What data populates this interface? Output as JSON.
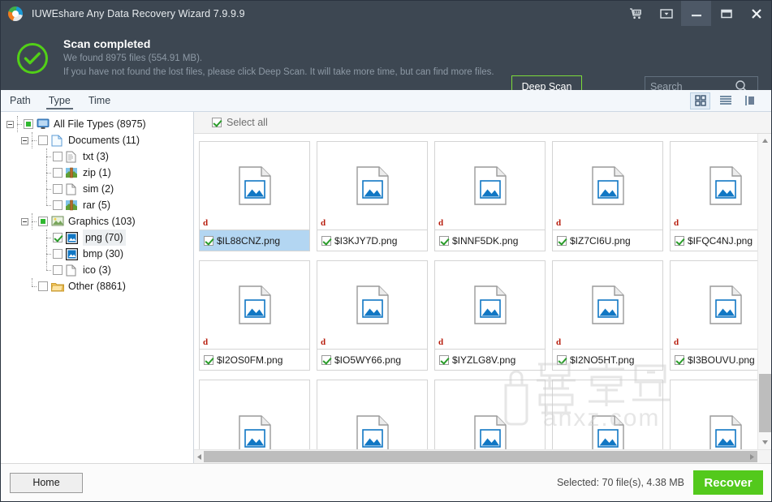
{
  "window": {
    "title": "IUWEshare Any Data Recovery Wizard 7.9.9.9",
    "logo_icon": "app-logo-icon",
    "buttons": [
      {
        "name": "cart-icon",
        "label": ""
      },
      {
        "name": "menu-dropdown-icon",
        "label": ""
      },
      {
        "name": "minimize-icon",
        "label": ""
      },
      {
        "name": "maximize-icon",
        "label": ""
      },
      {
        "name": "close-icon",
        "label": ""
      }
    ]
  },
  "scan": {
    "status_icon": "check-circle-icon",
    "title": "Scan completed",
    "line1": "We found 8975 files (554.91 MB).",
    "line2": "If you have not found the lost files, please click Deep Scan. It will take more time, but can find more files.",
    "deep_scan_label": "Deep Scan",
    "accent_green": "#7ddb3a"
  },
  "search": {
    "placeholder": "Search",
    "value": "",
    "icon": "search-icon"
  },
  "toolbar": {
    "tabs": [
      {
        "label": "Path",
        "active": false
      },
      {
        "label": "Type",
        "active": true
      },
      {
        "label": "Time",
        "active": false
      }
    ],
    "views": [
      {
        "name": "grid-view-icon",
        "active": true
      },
      {
        "name": "list-view-icon",
        "active": false
      },
      {
        "name": "detail-view-icon",
        "active": false
      }
    ]
  },
  "tree": [
    {
      "label": "All File Types (8975)",
      "level": 0,
      "check": "partial",
      "icon": "monitor-icon",
      "expander": true
    },
    {
      "label": "Documents (11)",
      "level": 1,
      "check": "empty",
      "icon": "document-icon",
      "expander": true
    },
    {
      "label": "txt (3)",
      "level": 2,
      "check": "empty",
      "icon": "txt-icon",
      "expander": false
    },
    {
      "label": "zip (1)",
      "level": 2,
      "check": "empty",
      "icon": "archive-icon",
      "expander": false
    },
    {
      "label": "sim (2)",
      "level": 2,
      "check": "empty",
      "icon": "blank-file-icon",
      "expander": false
    },
    {
      "label": "rar (5)",
      "level": 2,
      "check": "empty",
      "icon": "archive-icon",
      "expander": false
    },
    {
      "label": "Graphics (103)",
      "level": 1,
      "check": "partial",
      "icon": "graphics-icon",
      "expander": true
    },
    {
      "label": "png (70)",
      "level": 2,
      "check": "checked",
      "icon": "image-file-icon",
      "expander": false,
      "highlight": true
    },
    {
      "label": "bmp (30)",
      "level": 2,
      "check": "empty",
      "icon": "image-file-icon",
      "expander": false
    },
    {
      "label": "ico (3)",
      "level": 2,
      "check": "empty",
      "icon": "blank-file-icon",
      "expander": false
    },
    {
      "label": "Other (8861)",
      "level": 1,
      "check": "empty",
      "icon": "folder-icon",
      "expander": false
    }
  ],
  "filepane": {
    "select_all_label": "Select all",
    "select_all_checked": true,
    "badge_letter": "d",
    "files": [
      {
        "name": "$IL88CNZ.png",
        "checked": true,
        "selected": true
      },
      {
        "name": "$I3KJY7D.png",
        "checked": true,
        "selected": false
      },
      {
        "name": "$INNF5DK.png",
        "checked": true,
        "selected": false
      },
      {
        "name": "$IZ7CI6U.png",
        "checked": true,
        "selected": false
      },
      {
        "name": "$IFQC4NJ.png",
        "checked": true,
        "selected": false
      },
      {
        "name": "$I2OS0FM.png",
        "checked": true,
        "selected": false
      },
      {
        "name": "$IO5WY66.png",
        "checked": true,
        "selected": false
      },
      {
        "name": "$IYZLG8V.png",
        "checked": true,
        "selected": false
      },
      {
        "name": "$I2NO5HT.png",
        "checked": true,
        "selected": false
      },
      {
        "name": "$I3BOUVU.png",
        "checked": true,
        "selected": false
      },
      {
        "name": "",
        "checked": false,
        "selected": false
      },
      {
        "name": "",
        "checked": false,
        "selected": false
      },
      {
        "name": "",
        "checked": false,
        "selected": false
      },
      {
        "name": "",
        "checked": false,
        "selected": false
      },
      {
        "name": "",
        "checked": false,
        "selected": false
      }
    ]
  },
  "watermark": {
    "text_cn": "安下载",
    "text_url": "anxz.com"
  },
  "footer": {
    "home_label": "Home",
    "selection_info": "Selected: 70 file(s), 4.38 MB",
    "recover_label": "Recover",
    "recover_color": "#53c91c"
  }
}
